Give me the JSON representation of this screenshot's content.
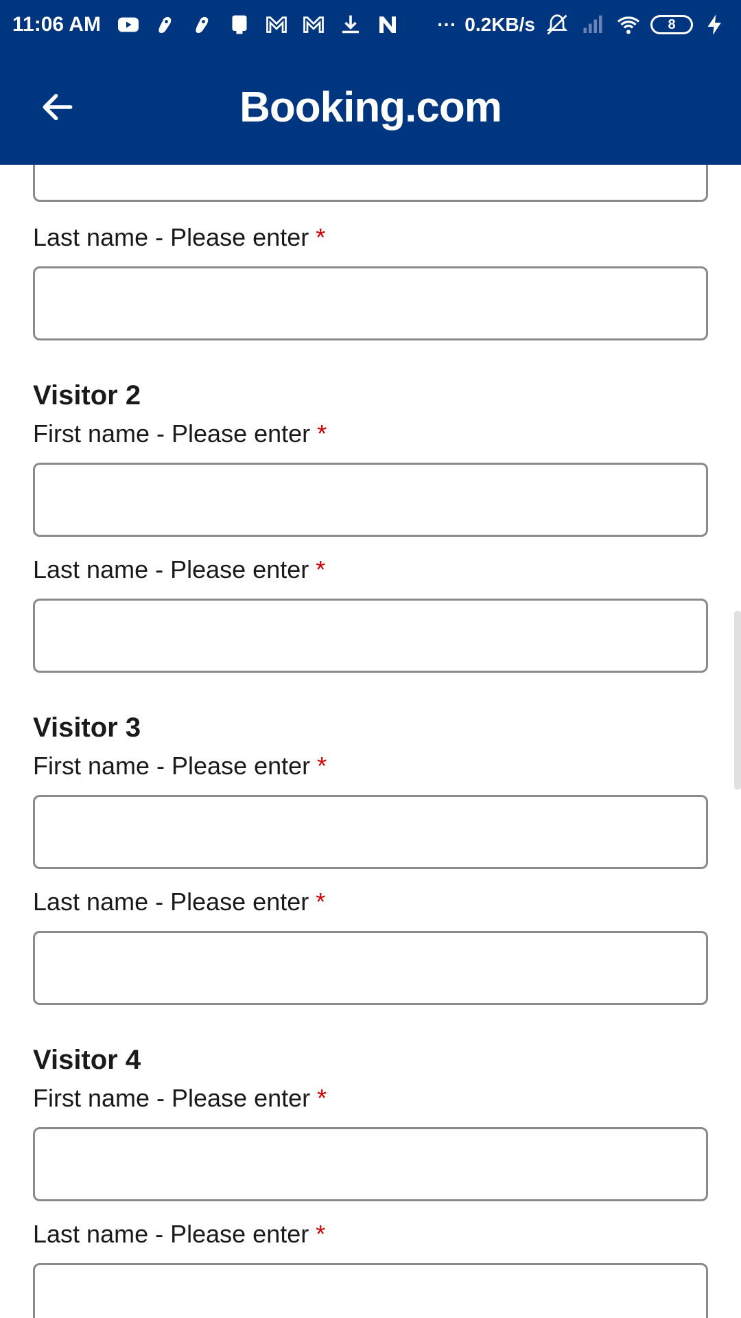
{
  "status_bar": {
    "time": "11:06 AM",
    "more_indicator": "···",
    "network_speed": "0.2KB/s",
    "battery_level": "8",
    "icons": [
      "youtube-icon",
      "app-icon",
      "app-icon",
      "clipboard-icon",
      "gmail-icon",
      "gmail-icon",
      "download-icon",
      "n-app-icon",
      "mute-icon",
      "signal-icon",
      "wifi-icon",
      "battery-icon",
      "charging-icon"
    ]
  },
  "app_bar": {
    "title": "Booking.com",
    "back_icon": "arrow-left-icon"
  },
  "colors": {
    "brand_navy": "#003580",
    "required": "#cc0000",
    "input_border": "#8a8a8a"
  },
  "form": {
    "top_last_name_label": "Last name - Please enter",
    "required_marker": "*",
    "visitors": [
      {
        "heading": "Visitor 2",
        "first_name_label": "First name - Please enter",
        "last_name_label": "Last name - Please enter",
        "first_name_value": "",
        "last_name_value": ""
      },
      {
        "heading": "Visitor 3",
        "first_name_label": "First name - Please enter",
        "last_name_label": "Last name - Please enter",
        "first_name_value": "",
        "last_name_value": ""
      },
      {
        "heading": "Visitor 4",
        "first_name_label": "First name - Please enter",
        "last_name_label": "Last name - Please enter",
        "first_name_value": "",
        "last_name_value": ""
      }
    ]
  }
}
